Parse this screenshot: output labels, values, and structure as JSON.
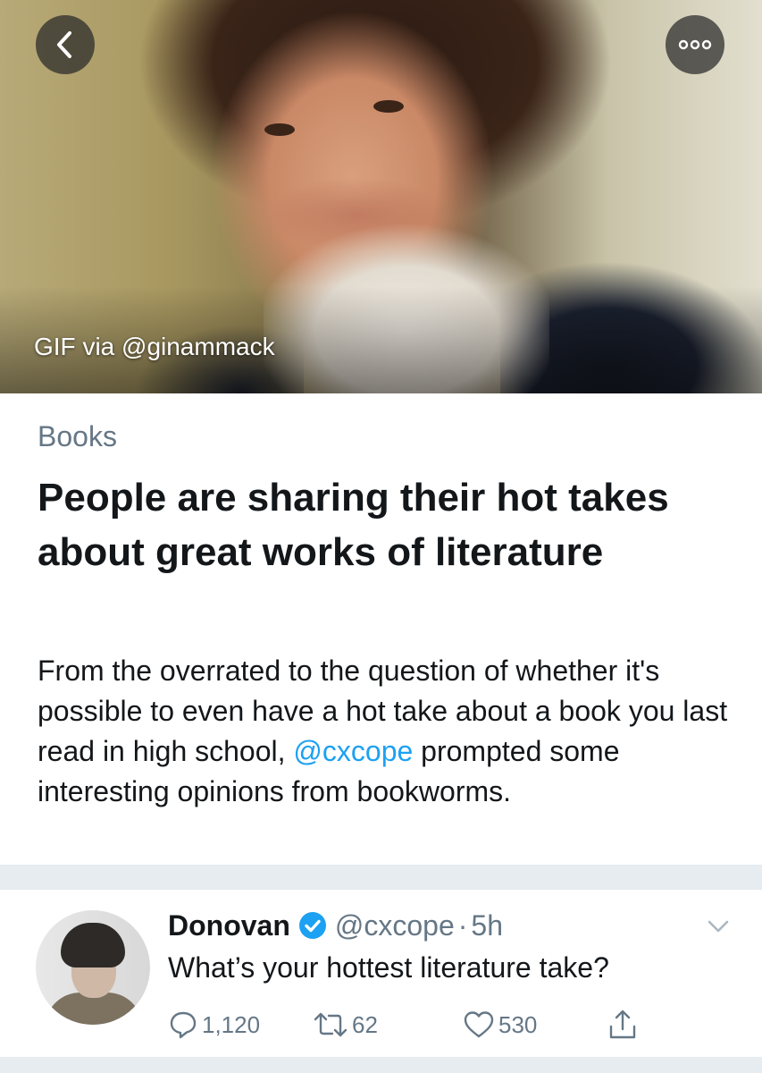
{
  "hero": {
    "credit": "GIF via @ginammack",
    "back_icon": "chevron-left-icon",
    "more_icon": "more-dots-icon"
  },
  "article": {
    "category": "Books",
    "headline": "People are sharing their hot takes about great works of literature",
    "summary_before": "From the overrated to the question of whether it's possible to even have a hot take about a book you last read in high school, ",
    "summary_mention": "@cxcope",
    "summary_after": " prompted some interesting opinions from bookworms."
  },
  "tweet": {
    "author": "Donovan",
    "handle": "@cxcope",
    "separator": "·",
    "time": "5h",
    "text": "What’s your hottest literature take?",
    "reply_count": "1,120",
    "retweet_count": "62",
    "like_count": "530"
  },
  "colors": {
    "accent": "#1da1f2",
    "muted": "#657786",
    "divider": "#e6ecf0"
  }
}
